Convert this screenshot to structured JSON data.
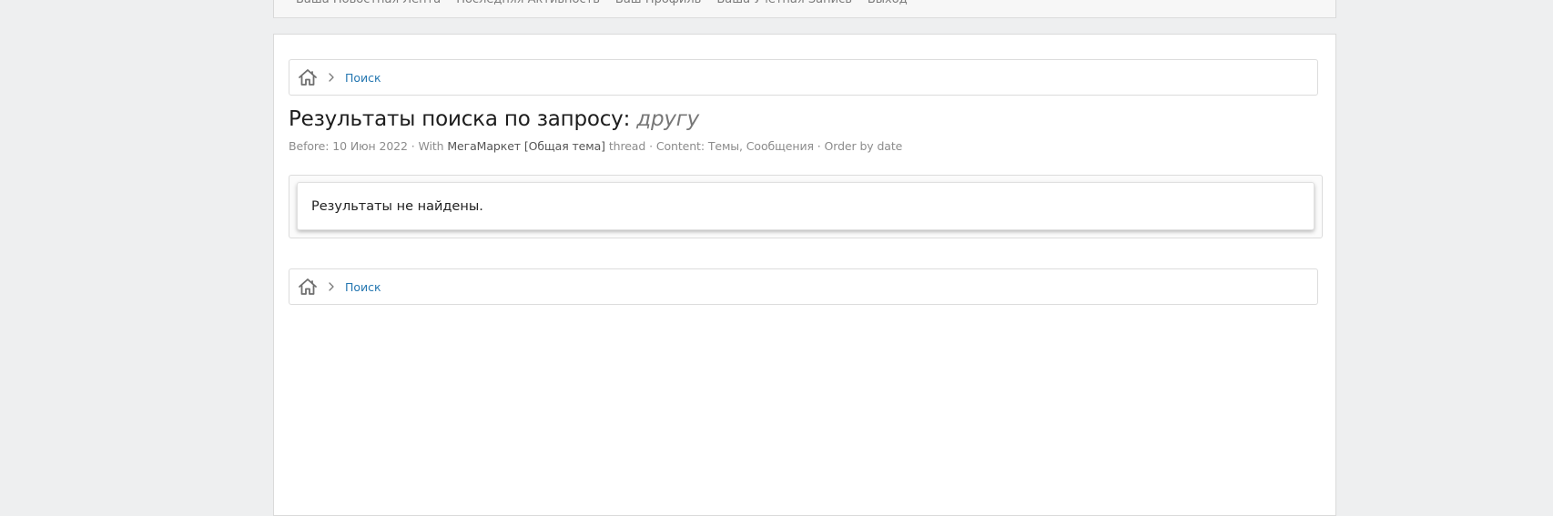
{
  "nav": {
    "items": [
      {
        "label": "Ваша Новостная Лента"
      },
      {
        "label": "Последняя Активность"
      },
      {
        "label": "Ваш Профиль"
      },
      {
        "label": "Ваша Учетная Запись"
      },
      {
        "label": "Выход"
      }
    ]
  },
  "breadcrumb": {
    "home_icon": "home-icon",
    "separator_icon": "chevron-right-icon",
    "items": [
      {
        "label": "Поиск"
      }
    ]
  },
  "page": {
    "title_prefix": "Результаты поиска по запросу:",
    "query": "другу"
  },
  "meta": {
    "before_label": "Before:",
    "before_date": "10 Июн 2022",
    "with_label": "· With",
    "thread_title": "МегаМаркет [Общая тема]",
    "thread_suffix": "thread",
    "content_text": "· Content: Темы, Сообщения",
    "order_text": "· Order by date"
  },
  "results": {
    "empty_message": "Результаты не найдены."
  },
  "colors": {
    "background": "#eeeff0",
    "panel": "#ffffff",
    "link": "#2577b1",
    "muted": "#8c8c8c"
  }
}
